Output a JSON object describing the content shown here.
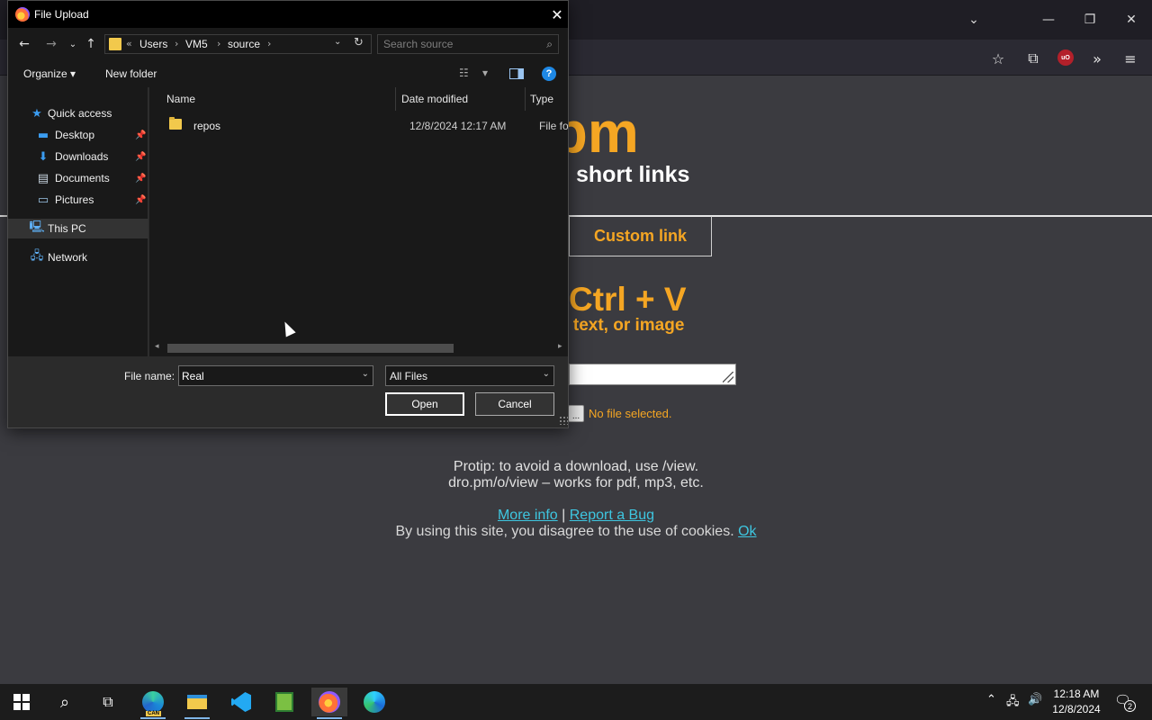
{
  "browser": {
    "window_controls": {
      "tab_list": "⌄",
      "minimize": "—",
      "restore": "❐",
      "close": "✕"
    },
    "toolbar_icons": {
      "bookmark": "☆",
      "extensions": "⧉",
      "ublock": "uO",
      "overflow": "»",
      "menu": "≡"
    }
  },
  "page": {
    "logo": ".pm",
    "tagline": "short links",
    "custom_link_tab": "Custom link",
    "paste_title": "Ctrl + V",
    "paste_subtitle": "t, text, or image",
    "browse_button": "...",
    "no_file": "No file selected.",
    "protip_line1": "Protip: to avoid a download, use /view.",
    "protip_line2": "dro.pm/o/view – works for pdf, mp3, etc.",
    "more_info": "More info",
    "links_sep": "|",
    "report_bug": "Report a Bug",
    "cookie_text": "By using this site, you disagree to the use of cookies.",
    "cookie_ok": "Ok"
  },
  "dialog": {
    "title": "File Upload",
    "close": "✕",
    "nav": {
      "back": "←",
      "forward": "→",
      "recent": "⌄",
      "up": "↑"
    },
    "address": {
      "more": "«",
      "segments": [
        "Users",
        "VM5",
        "source"
      ],
      "sep": "›",
      "dropdown": "⌄",
      "refresh": "↻"
    },
    "search_placeholder": "Search source",
    "commands": {
      "organize": "Organize ▾",
      "new_folder": "New folder",
      "view_dropdown": "▾",
      "help": "?"
    },
    "nav_pane": {
      "quick_access": "Quick access",
      "items": [
        {
          "label": "Desktop",
          "icon": "desktop-icon",
          "pinned": true
        },
        {
          "label": "Downloads",
          "icon": "download-icon",
          "pinned": true
        },
        {
          "label": "Documents",
          "icon": "document-icon",
          "pinned": true
        },
        {
          "label": "Pictures",
          "icon": "picture-icon",
          "pinned": true
        }
      ],
      "this_pc": "This PC",
      "network": "Network",
      "pin_glyph": "📌"
    },
    "columns": {
      "name": "Name",
      "date": "Date modified",
      "type": "Type"
    },
    "files": [
      {
        "name": "repos",
        "date": "12/8/2024 12:17 AM",
        "type": "File folder"
      }
    ],
    "file_name_label": "File name:",
    "file_name_value": "Real",
    "file_type": "All Files",
    "open_button": "Open",
    "cancel_button": "Cancel"
  },
  "taskbar": {
    "time": "12:18 AM",
    "date": "12/8/2024",
    "notification_count": "2",
    "edge_dev_badge": "CAN",
    "tray": {
      "chevron": "⌃",
      "network": "🖧",
      "volume": "🔊",
      "notifications": "🗨"
    }
  }
}
